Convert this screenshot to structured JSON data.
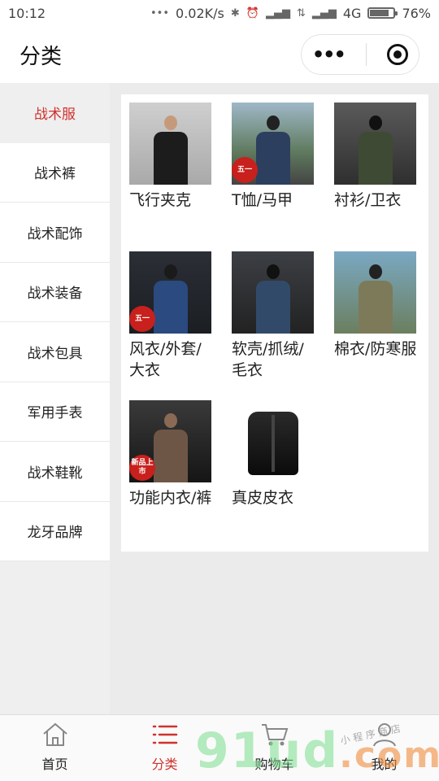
{
  "status": {
    "time": "10:12",
    "speed": "0.02K/s",
    "network": "4G",
    "battery": "76%"
  },
  "header": {
    "title": "分类"
  },
  "sidebar": {
    "items": [
      {
        "label": "战术服"
      },
      {
        "label": "战术裤"
      },
      {
        "label": "战术配饰"
      },
      {
        "label": "战术装备"
      },
      {
        "label": "战术包具"
      },
      {
        "label": "军用手表"
      },
      {
        "label": "战术鞋靴"
      },
      {
        "label": "龙牙品牌"
      }
    ]
  },
  "categories": [
    {
      "label": "飞行夹克"
    },
    {
      "label": "T恤/马甲",
      "badge": "五一"
    },
    {
      "label": "衬衫/卫衣"
    },
    {
      "label": "风衣/外套/大衣",
      "badge": "五一"
    },
    {
      "label": "软壳/抓绒/毛衣"
    },
    {
      "label": "棉衣/防寒服"
    },
    {
      "label": "功能内衣/裤",
      "badge": "新品上市"
    },
    {
      "label": "真皮皮衣"
    }
  ],
  "tabs": [
    {
      "label": "首页"
    },
    {
      "label": "分类"
    },
    {
      "label": "购物车"
    },
    {
      "label": "我的"
    }
  ],
  "watermark": {
    "main": "91ud",
    "suffix": ".com",
    "small": "小 程 序 商 店"
  },
  "colors": {
    "accent": "#d0312d",
    "sidebar_bg": "#efefef",
    "content_bg": "#ebebeb"
  }
}
